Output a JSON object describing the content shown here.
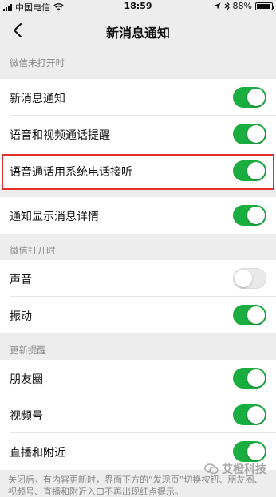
{
  "status_bar": {
    "carrier": "中国电信",
    "time": "18:59",
    "battery_percent": "88%",
    "battery_level": 0.88
  },
  "nav": {
    "title": "新消息通知"
  },
  "sections": [
    {
      "header": "微信未打开时",
      "items": [
        {
          "label": "新消息通知",
          "on": true
        },
        {
          "label": "语音和视频通话提醒",
          "on": true
        },
        {
          "label": "语音通话用系统电话接听",
          "on": true
        },
        {
          "label": "通知显示消息详情",
          "on": true
        }
      ]
    },
    {
      "header": "微信打开时",
      "items": [
        {
          "label": "声音",
          "on": false
        },
        {
          "label": "振动",
          "on": true
        }
      ]
    },
    {
      "header": "更新提醒",
      "items": [
        {
          "label": "朋友圈",
          "on": true
        },
        {
          "label": "视频号",
          "on": true
        },
        {
          "label": "直播和附近",
          "on": true
        }
      ]
    }
  ],
  "footer_note": "关闭后，有内容更新时，界面下方的“发现页”切换按钮、朋友圈、视频号、直播和附近入口不再出现红点提示。",
  "watermark": "艾橙科技",
  "colors": {
    "toggle_on": "#1aad3f",
    "highlight_border": "#e0302f"
  }
}
